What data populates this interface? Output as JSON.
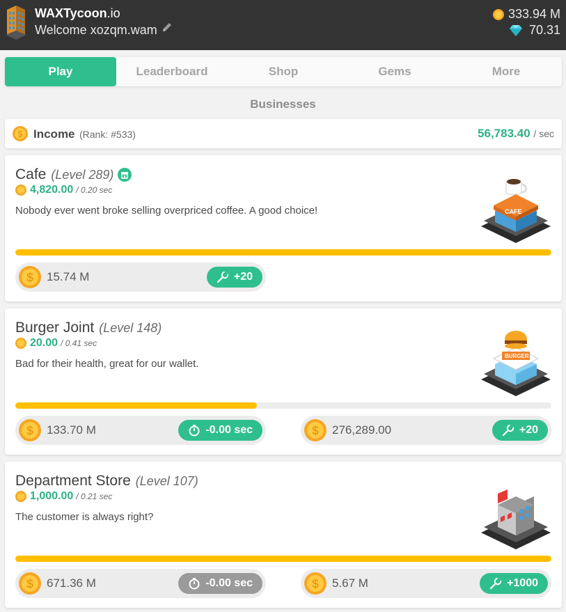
{
  "header": {
    "app_name": "WAXTycoon",
    "app_tld": ".io",
    "welcome": "Welcome xozqm.wam",
    "coins": "333.94 M",
    "gems": "70.31"
  },
  "nav": {
    "tabs": [
      "Play",
      "Leaderboard",
      "Shop",
      "Gems",
      "More"
    ],
    "active": "Play"
  },
  "section_title": "Businesses",
  "income": {
    "label": "Income",
    "rank": "(Rank: #533)",
    "value": "56,783.40",
    "unit": "/ sec"
  },
  "businesses": [
    {
      "name": "Cafe",
      "level": "(Level 289)",
      "rate": "4,820.00",
      "per": "/ 0.20 sec",
      "description": "Nobody ever went broke selling overpriced coffee. A good choice!",
      "progress": 1.0,
      "upgrade_cost": "15.74 M",
      "upgrade_label": "+20"
    },
    {
      "name": "Burger Joint",
      "level": "(Level 148)",
      "rate": "20.00",
      "per": "/ 0.41 sec",
      "description": "Bad for their health, great for our wallet.",
      "progress": 0.45,
      "speed_cost": "133.70 M",
      "speed_label": "-0.00 sec",
      "upgrade_cost": "276,289.00",
      "upgrade_label": "+20"
    },
    {
      "name": "Department Store",
      "level": "(Level 107)",
      "rate": "1,000.00",
      "per": "/ 0.21 sec",
      "description": "The customer is always right?",
      "progress": 1.0,
      "speed_cost": "671.36 M",
      "speed_label": "-0.00 sec",
      "upgrade_cost": "5.67 M",
      "upgrade_label": "+1000"
    }
  ],
  "colors": {
    "accent": "#2fbf8f",
    "progress": "#ffbf00",
    "header_bg": "#333333",
    "disabled": "#9a9a9a"
  },
  "icons": [
    "building-logo-icon",
    "pencil-icon",
    "coin-icon",
    "gem-icon",
    "store-badge-icon",
    "wrench-icon",
    "stopwatch-icon"
  ]
}
